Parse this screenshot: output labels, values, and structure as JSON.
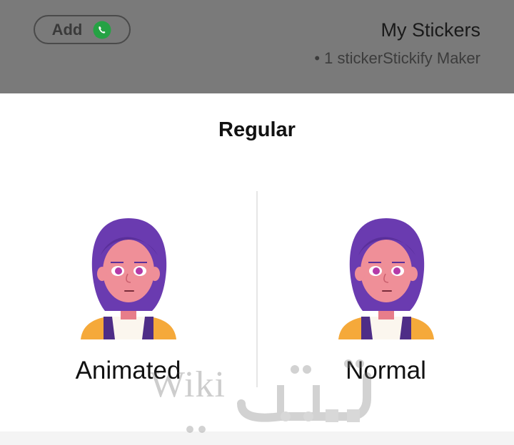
{
  "header": {
    "add_label": "Add",
    "add_icon": "whatsapp-icon",
    "pack_title": "My Stickers",
    "pack_subtitle": "• 1 stickerStickify Maker"
  },
  "sheet": {
    "title": "Regular",
    "options": [
      {
        "label": "Animated",
        "icon": "cartoon-girl-avatar"
      },
      {
        "label": "Normal",
        "icon": "cartoon-girl-avatar"
      }
    ]
  },
  "watermark": {
    "latin": "Wiki",
    "arabic": "تقني"
  },
  "colors": {
    "header_bg": "#7a7a7a",
    "whatsapp_green": "#25a244",
    "hair": "#6a3bb0",
    "skin": "#ef8f98",
    "shirt": "#f5a93a"
  }
}
